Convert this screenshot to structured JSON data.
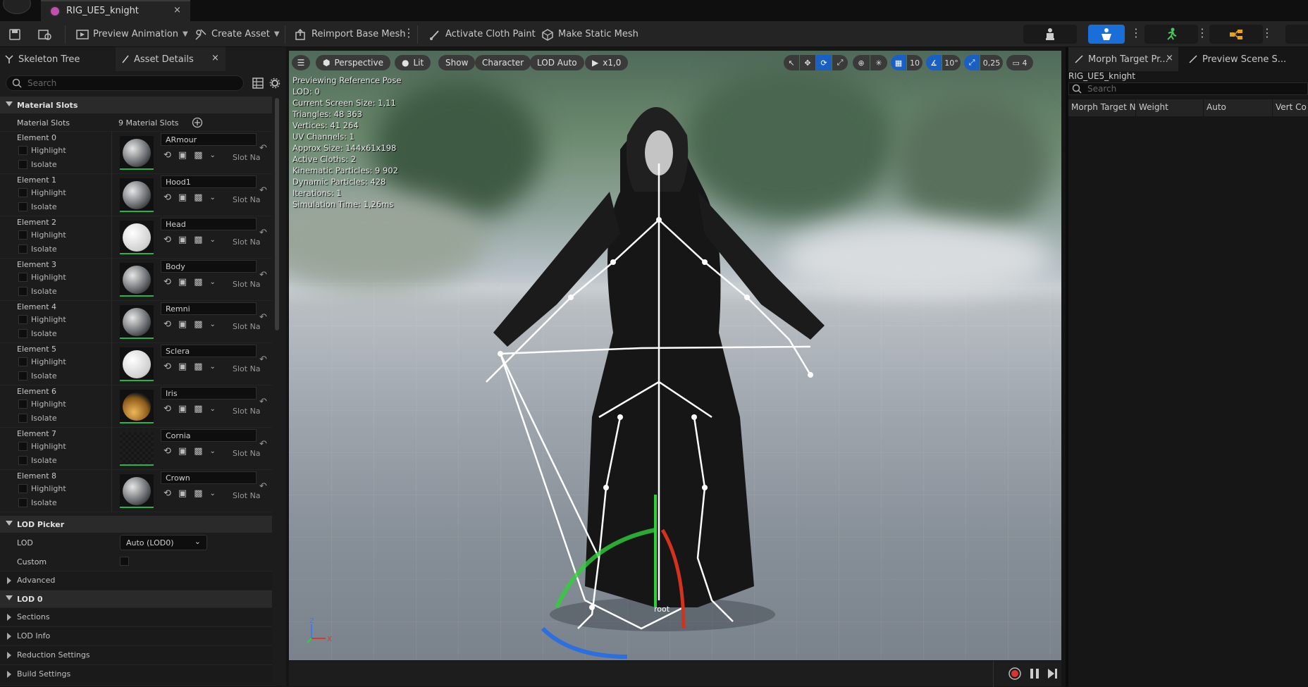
{
  "window": {
    "tab_title": "RIG_UE5_knight",
    "close": "×"
  },
  "toolbar": {
    "preview_animation": "Preview Animation",
    "create_asset": "Create Asset",
    "reimport_base_mesh": "Reimport Base Mesh",
    "activate_cloth_paint": "Activate Cloth Paint",
    "make_static_mesh": "Make Static Mesh"
  },
  "left_panel": {
    "tabs": [
      {
        "label": "Skeleton Tree"
      },
      {
        "label": "Asset Details",
        "close": "×"
      }
    ],
    "search_placeholder": "Search",
    "material_slots_section": "Material Slots",
    "material_slots_label": "Material Slots",
    "material_slots_count": "9 Material Slots",
    "elements": [
      {
        "label": "Element 0",
        "material": "ARmour",
        "ball": "#c9ccce",
        "style": "dark"
      },
      {
        "label": "Element 1",
        "material": "Hood1",
        "ball": "#c9ccce",
        "style": "dark"
      },
      {
        "label": "Element 2",
        "material": "Head",
        "ball": "#f1f1f1",
        "style": "white"
      },
      {
        "label": "Element 3",
        "material": "Body",
        "ball": "#c9ccce",
        "style": "dark"
      },
      {
        "label": "Element 4",
        "material": "Remni",
        "ball": "#c9ccce",
        "style": "dark"
      },
      {
        "label": "Element 5",
        "material": "Sclera",
        "ball": "#f1f1f1",
        "style": "white"
      },
      {
        "label": "Element 6",
        "material": "Iris",
        "ball": "#d9a24a",
        "style": "orange"
      },
      {
        "label": "Element 7",
        "material": "Cornia",
        "ball": "#1a1a1a",
        "style": "black"
      },
      {
        "label": "Element 8",
        "material": "Crown",
        "ball": "#c9ccce",
        "style": "dark"
      }
    ],
    "highlight_label": "Highlight",
    "isolate_label": "Isolate",
    "slot_name_label": "Slot Na",
    "lod_picker_section": "LOD Picker",
    "lod_label": "LOD",
    "lod_value": "Auto (LOD0)",
    "custom_label": "Custom",
    "advanced_label": "Advanced",
    "lod0_section": "LOD 0",
    "lod0_items": [
      {
        "label": "Sections"
      },
      {
        "label": "LOD Info"
      },
      {
        "label": "Reduction Settings"
      },
      {
        "label": "Build Settings"
      }
    ]
  },
  "viewport": {
    "perspective": "Perspective",
    "lit": "Lit",
    "show": "Show",
    "character": "Character",
    "lod_auto": "LOD Auto",
    "speed": "x1,0",
    "grid_value": "10",
    "angle_value": "10°",
    "scale_value": "0,25",
    "camera_value": "4",
    "stats": [
      "Previewing Reference Pose",
      "LOD: 0",
      "Current Screen Size: 1,11",
      "Triangles: 48 363",
      "Vertices: 41 264",
      "UV Channels: 1",
      "Approx Size: 144x61x198",
      "Active Cloths: 2",
      "Kinematic Particles: 9 902",
      "Dynamic Particles: 428",
      "Iterations: 1",
      "Simulation Time: 1,26ms"
    ],
    "root_bone_label": "root",
    "axis_z": "Z",
    "axis_x": "X"
  },
  "right_panel": {
    "tabs": [
      {
        "label": "Morph Target Pr...",
        "close": "×"
      },
      {
        "label": "Preview Scene S..."
      }
    ],
    "asset_name": "RIG_UE5_knight",
    "search_placeholder": "Search",
    "columns": [
      "Morph Target N",
      "Weight",
      "Auto",
      "Vert Co"
    ]
  },
  "colors": {
    "accent_blue": "#1a6ed8",
    "thumb_green": "#2bb24a"
  }
}
